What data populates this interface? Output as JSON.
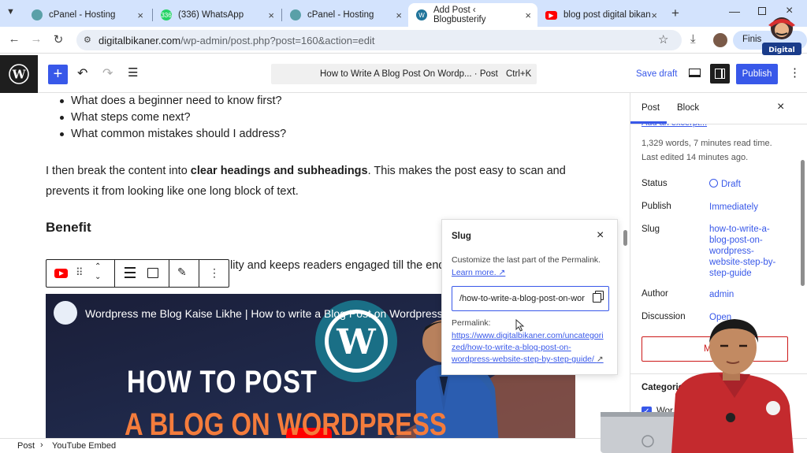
{
  "browser": {
    "tabs": [
      {
        "title": "cPanel - Hosting"
      },
      {
        "title": "(336) WhatsApp",
        "badge": "336"
      },
      {
        "title": "cPanel - Hosting"
      },
      {
        "title": "Add Post ‹ Blogbusterify"
      },
      {
        "title": "blog post digital bikana"
      }
    ],
    "url_host": "digitalbikaner.com",
    "url_path": "/wp-admin/post.php?post=160&action=edit",
    "profile_label": "Finis"
  },
  "wp_toolbar": {
    "command_text": "How to Write A Blog Post On Wordp... · Post",
    "shortcut": "Ctrl+K",
    "save_draft": "Save draft",
    "publish": "Publish"
  },
  "editor": {
    "bullets": [
      "What does a beginner need to know first?",
      "What steps come next?",
      "What common mistakes should I address?"
    ],
    "para_pre": "I then break the content into ",
    "para_bold": "clear headings and subheadings",
    "para_post": ". This makes the post easy to scan and",
    "para_line2": "prevents it from looking like one long block of text.",
    "heading": "Benefit",
    "partial_text": "lity and keeps readers engaged till the end",
    "video_title": "Wordpress me Blog Kaise Likhe | How to write a Blog Post on Wordpress",
    "thumb_line1": "HOW TO POST",
    "thumb_line2": "A BLOG ON WORDPRESS"
  },
  "sidebar": {
    "tabs": [
      "Post",
      "Block"
    ],
    "excerpt_link": "Add an excerpt...",
    "stats": "1,329 words, 7 minutes read time.",
    "last_edited": "Last edited 14 minutes ago.",
    "fields": {
      "status_label": "Status",
      "status_value": "Draft",
      "publish_label": "Publish",
      "publish_value": "Immediately",
      "slug_label": "Slug",
      "slug_value": [
        "how-to-write-a-",
        "blog-post-on-",
        "wordpress-",
        "website-step-by-",
        "step-guide"
      ],
      "author_label": "Author",
      "author_value": "admin",
      "discussion_label": "Discussion",
      "discussion_value": "Open"
    },
    "move_button": "Move",
    "categories_heading": "Categories",
    "category_item": "Wor"
  },
  "slug_popover": {
    "title": "Slug",
    "description": "Customize the last part of the Permalink.",
    "learn_more": "Learn more.",
    "input_value": "/how-to-write-a-blog-post-on-wor",
    "permalink_label": "Permalink:",
    "permalink_lines": [
      "https://www.digitalbikaner.com/uncategori",
      "zed/how-to-write-a-blog-post-on-",
      "wordpress-website-step-by-step-guide/"
    ]
  },
  "statusbar": {
    "crumb1": "Post",
    "crumb2": "YouTube Embed"
  },
  "colors": {
    "accent": "#3858e9",
    "chrome_tabstrip": "#d3e3fd",
    "wp_dark": "#1e1e1e",
    "youtube_red": "#ff0000"
  }
}
